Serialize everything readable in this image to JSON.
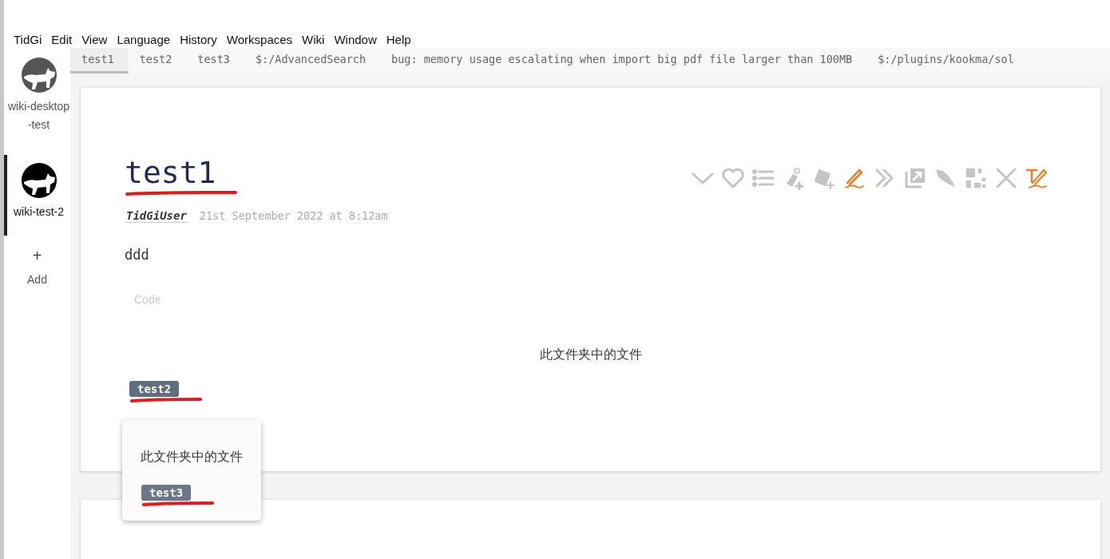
{
  "menu": [
    "TidGi",
    "Edit",
    "View",
    "Language",
    "History",
    "Workspaces",
    "Wiki",
    "Window",
    "Help"
  ],
  "workspaces": [
    {
      "name": "wiki-desktop-test",
      "selected": false
    },
    {
      "name": "wiki-test-2",
      "selected": true
    }
  ],
  "add_workspace": {
    "icon": "+",
    "label": "Add"
  },
  "tabs": [
    {
      "label": "test1",
      "selected": true
    },
    {
      "label": "test2",
      "selected": false
    },
    {
      "label": "test3",
      "selected": false
    },
    {
      "label": "$:/AdvancedSearch",
      "selected": false
    },
    {
      "label": "bug: memory usage escalating when import big pdf file larger than 100MB",
      "selected": false
    },
    {
      "label": "$:/plugins/kookma/sol",
      "selected": false
    }
  ],
  "tiddler": {
    "title": "test1",
    "modifier": "TidGiUser",
    "date": "21st September 2022 at 8:12am",
    "body": "ddd",
    "code_label": "Code",
    "folder_heading": "此文件夹中的文件",
    "links": [
      "test2"
    ]
  },
  "popup": {
    "heading": "此文件夹中的文件",
    "links": [
      "test3"
    ]
  }
}
